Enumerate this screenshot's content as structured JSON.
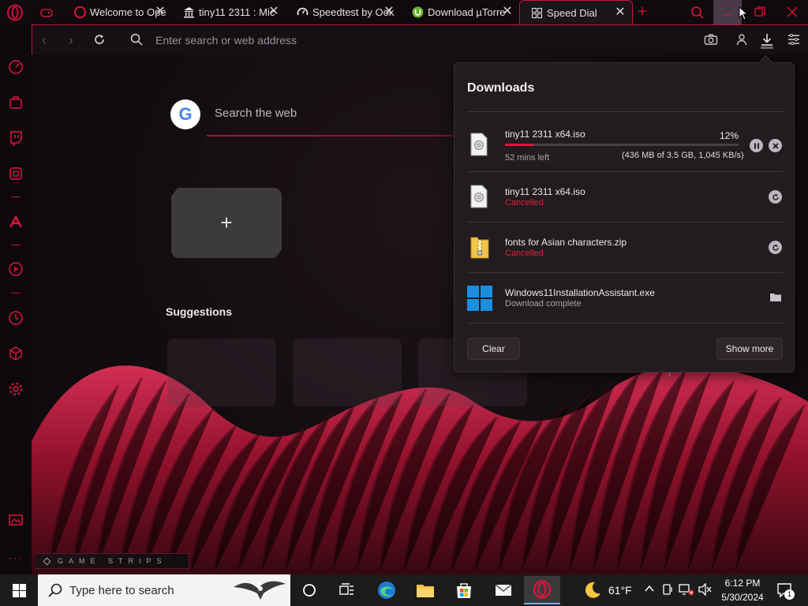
{
  "tabs": [
    {
      "label": "Welcome to Ope",
      "icon": "opera-icon"
    },
    {
      "label": "tiny11 2311 : Mic",
      "icon": "archive-icon"
    },
    {
      "label": "Speedtest by Ook",
      "icon": "speedtest-icon"
    },
    {
      "label": "Download µTorre",
      "icon": "utorrent-icon"
    },
    {
      "label": "Speed Dial",
      "icon": "grid-icon",
      "active": true
    }
  ],
  "address_bar": {
    "placeholder": "Enter search or web address"
  },
  "speed_dial": {
    "search_placeholder": "Search the web",
    "google_letter": "G",
    "add_label": "+",
    "suggestions_heading": "Suggestions",
    "game_strips": "GAME STRIPS"
  },
  "downloads": {
    "title": "Downloads",
    "items": [
      {
        "name": "tiny11 2311 x64.iso",
        "percent": "12%",
        "progress": 0.12,
        "time_left": "52 mins left",
        "detail": "(436 MB of 3.5 GB, 1,045 KB/s)",
        "status": "downloading",
        "icon": "disc-image-icon"
      },
      {
        "name": "tiny11 2311 x64.iso",
        "status_text": "Cancelled",
        "status": "cancelled",
        "icon": "disc-image-icon"
      },
      {
        "name": "fonts for Asian characters.zip",
        "status_text": "Cancelled",
        "status": "cancelled",
        "icon": "zip-folder-icon"
      },
      {
        "name": "Windows11InstallationAssistant.exe",
        "status_text": "Download complete",
        "status": "complete",
        "icon": "windows-logo-icon"
      }
    ],
    "clear_label": "Clear",
    "show_more_label": "Show more"
  },
  "taskbar": {
    "search_placeholder": "Type here to search",
    "weather": "61°F",
    "time": "6:12 PM",
    "date": "5/30/2024",
    "notification_count": "1"
  },
  "colors": {
    "accent": "#c8143c",
    "panel": "#221b1f",
    "cancelled": "#e0203c"
  }
}
